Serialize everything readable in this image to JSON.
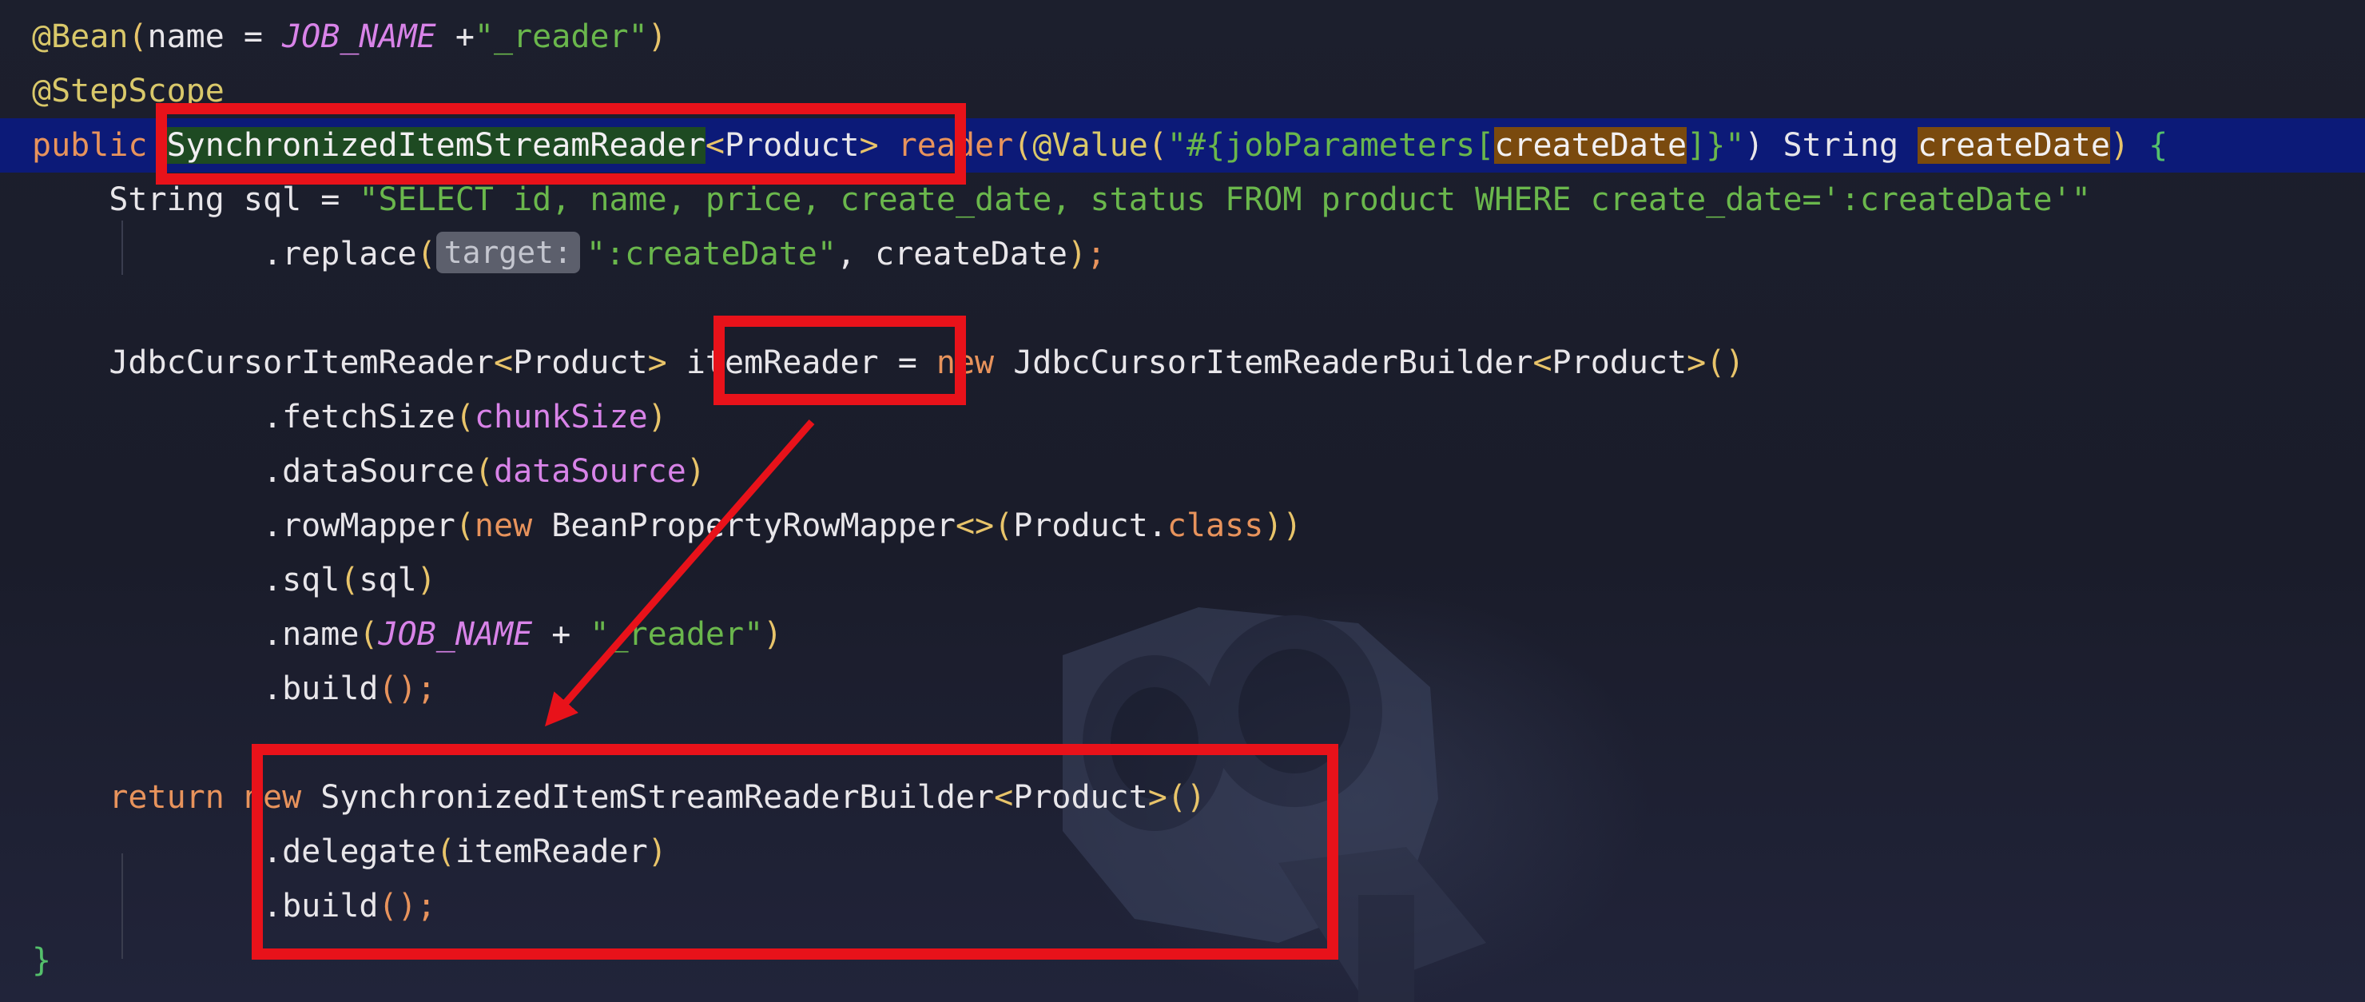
{
  "colors": {
    "background": "#1a1d2b",
    "current_line": "#0c1a78",
    "annotation": "#d9c86a",
    "keyword": "#e8935c",
    "string": "#6ab74c",
    "constant": "#d883e8",
    "highlight_box": "#e8121a"
  },
  "code": {
    "line1": {
      "t1": "@Bean",
      "t2": "(",
      "t3": "name = ",
      "t4": "JOB_NAME",
      "t5": " +",
      "t6": "\"_reader\"",
      "t7": ")"
    },
    "line2": {
      "t1": "@StepScope"
    },
    "line3": {
      "t1": "public ",
      "t2": "SynchronizedItemStreamReader",
      "t3": "<",
      "t4": "Product",
      "t5": ">",
      "t6": " reader",
      "t7": "(",
      "t8": "@Value",
      "t9": "(",
      "t10": "\"#{jobParameters[",
      "t11": "createDate",
      "t12": "]}\"",
      "t13": ") String ",
      "t14": "createDate",
      "t15": ")",
      "t16": " {"
    },
    "line4": {
      "t1": "    String sql = ",
      "t2": "\"SELECT id, name, price, create_date, status FROM product WHERE create_date=':createDate'\""
    },
    "line5": {
      "t1": "            .replace",
      "t2": "(",
      "hint": "target:",
      "t3": "\":createDate\"",
      "t4": ", createDate",
      "t5": ")",
      "t6": ";"
    },
    "line7": {
      "t1": "    JdbcCursorItemReader",
      "t2": "<",
      "t3": "Product",
      "t4": ">",
      "t5": " itemReader = ",
      "t6": "new",
      "t7": " JdbcCursorItemReaderBuilder",
      "t8": "<",
      "t9": "Product",
      "t10": ">",
      "t11": "()"
    },
    "line8": {
      "t1": "            .fetchSize",
      "t2": "(",
      "t3": "chunkSize",
      "t4": ")"
    },
    "line9": {
      "t1": "            .dataSource",
      "t2": "(",
      "t3": "dataSource",
      "t4": ")"
    },
    "line10": {
      "t1": "            .rowMapper",
      "t2": "(",
      "t3": "new",
      "t4": " BeanPropertyRowMapper",
      "t5": "<>",
      "t6": "(",
      "t7": "Product.",
      "t8": "class",
      "t9": ")",
      "t10": ")"
    },
    "line11": {
      "t1": "            .sql",
      "t2": "(",
      "t3": "sql",
      "t4": ")"
    },
    "line12": {
      "t1": "            .name",
      "t2": "(",
      "t3": "JOB_NAME",
      "t4": " + ",
      "t5": "\"_reader\"",
      "t6": ")"
    },
    "line13": {
      "t1": "            .build",
      "t2": "();"
    },
    "line15": {
      "t1": "    ",
      "t2": "return",
      "t3": " ",
      "t4": "new",
      "t5": " SynchronizedItemStreamReaderBuilder",
      "t6": "<",
      "t7": "Product",
      "t8": ">",
      "t9": "()"
    },
    "line16": {
      "t1": "            .delegate",
      "t2": "(",
      "t3": "itemReader",
      "t4": ")"
    },
    "line17": {
      "t1": "            .build",
      "t2": "();"
    },
    "line18": {
      "t1": "}"
    }
  }
}
